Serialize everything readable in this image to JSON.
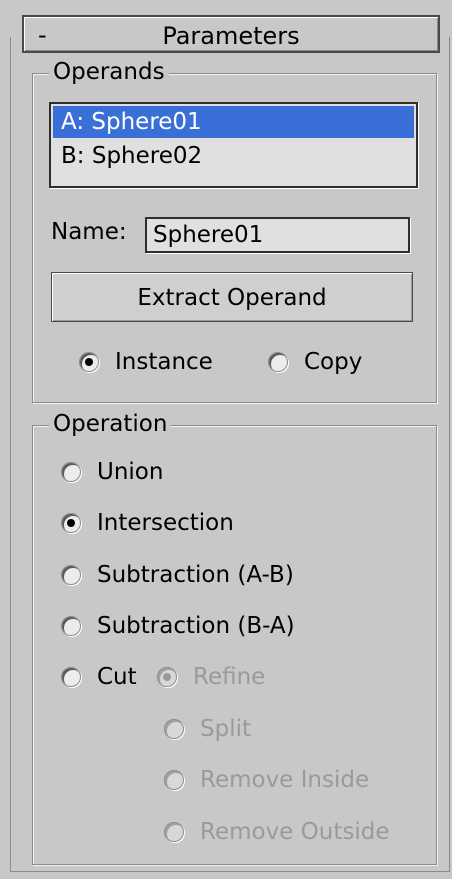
{
  "rollout": {
    "toggle": "-",
    "title": "Parameters"
  },
  "operands": {
    "group_title": "Operands",
    "list": [
      "A: Sphere01",
      "B: Sphere02"
    ],
    "selected_index": 0,
    "name_label": "Name:",
    "name_value": "Sphere01",
    "extract_button": "Extract Operand",
    "mode_options": [
      {
        "label": "Instance",
        "checked": true
      },
      {
        "label": "Copy",
        "checked": false
      }
    ]
  },
  "operation": {
    "group_title": "Operation",
    "options": [
      {
        "label": "Union",
        "checked": false
      },
      {
        "label": "Intersection",
        "checked": true
      },
      {
        "label": "Subtraction (A-B)",
        "checked": false
      },
      {
        "label": "Subtraction (B-A)",
        "checked": false
      },
      {
        "label": "Cut",
        "checked": false
      }
    ],
    "cut_options": [
      {
        "label": "Refine",
        "checked": true,
        "disabled": true
      },
      {
        "label": "Split",
        "checked": false,
        "disabled": true
      },
      {
        "label": "Remove Inside",
        "checked": false,
        "disabled": true
      },
      {
        "label": "Remove Outside",
        "checked": false,
        "disabled": true
      }
    ]
  },
  "colors": {
    "panel_bg": "#c8c8c8",
    "selection": "#3a6fd8",
    "disabled_text": "#9a9a9a"
  }
}
